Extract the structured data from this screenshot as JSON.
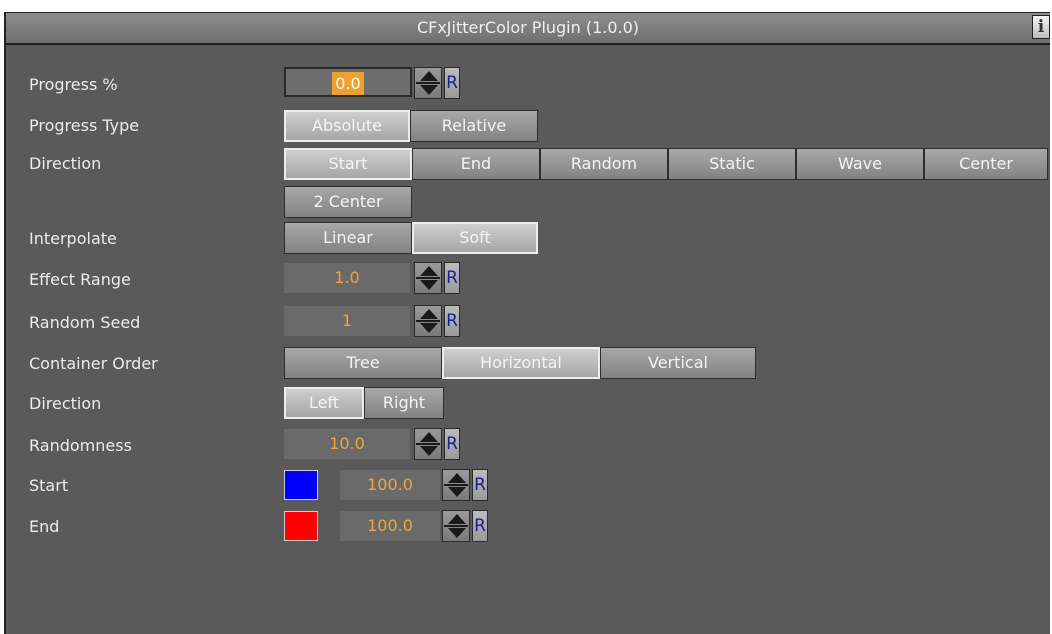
{
  "window": {
    "title": "CFxJitterColor Plugin (1.0.0)",
    "info_label": "i"
  },
  "labels": {
    "progress": "Progress %",
    "progress_type": "Progress Type",
    "direction": "Direction",
    "interpolate": "Interpolate",
    "effect_range": "Effect Range",
    "random_seed": "Random Seed",
    "container_order": "Container Order",
    "direction2": "Direction",
    "randomness": "Randomness",
    "start": "Start",
    "end": "End"
  },
  "values": {
    "progress": "0.0",
    "effect_range": "1.0",
    "random_seed": "1",
    "randomness": "10.0",
    "start": "100.0",
    "end": "100.0"
  },
  "reset_label": "R",
  "progress_type": {
    "options": [
      "Absolute",
      "Relative"
    ],
    "selected": "Absolute"
  },
  "direction": {
    "options": [
      "Start",
      "End",
      "Random",
      "Static",
      "Wave",
      "Center",
      "2 Center"
    ],
    "selected": "Start"
  },
  "interpolate": {
    "options": [
      "Linear",
      "Soft"
    ],
    "selected": "Soft"
  },
  "container_order": {
    "options": [
      "Tree",
      "Horizontal",
      "Vertical"
    ],
    "selected": "Horizontal"
  },
  "direction2": {
    "options": [
      "Left",
      "Right"
    ],
    "selected": "Left"
  },
  "colors": {
    "start": "#0000ff",
    "end": "#ff0000",
    "value_text": "#f2a33a"
  }
}
